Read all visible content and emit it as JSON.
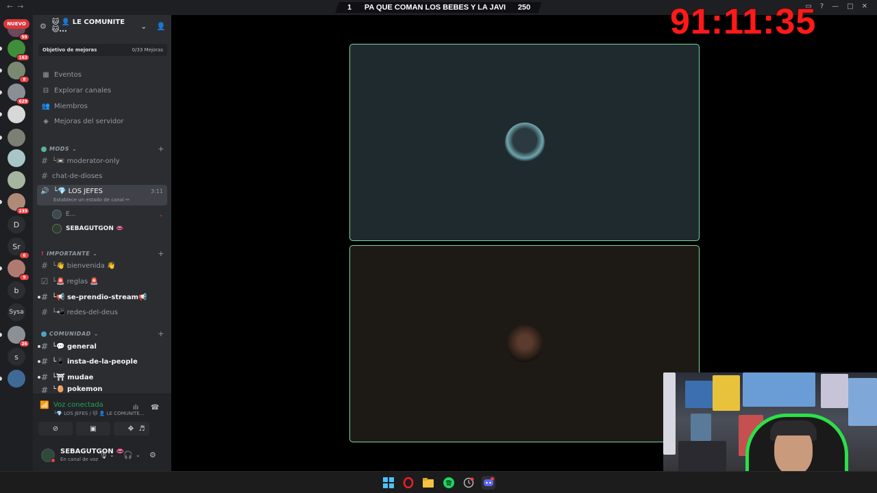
{
  "overlay": {
    "left_value": "1",
    "title": "PA QUE COMAN LOS BEBES Y LA JAVI",
    "right_value": "250"
  },
  "timer": "91:11:35",
  "rail": {
    "new_badge": "NUEVO",
    "servers": [
      {
        "badge": "59"
      },
      {
        "badge": "163"
      },
      {
        "badge": "8"
      },
      {
        "badge": "629"
      },
      {
        "badge": ""
      },
      {
        "badge": ""
      },
      {
        "badge": ""
      },
      {
        "badge": ""
      },
      {
        "badge": "235"
      },
      {
        "label": "D",
        "badge": ""
      },
      {
        "label": "Sr",
        "badge": "6"
      },
      {
        "badge": "9"
      },
      {
        "label": "b",
        "badge": ""
      },
      {
        "label": "Sysa",
        "badge": ""
      },
      {
        "badge": "26"
      },
      {
        "label": "s",
        "badge": ""
      },
      {
        "badge": ""
      }
    ]
  },
  "guild": {
    "name": "🐱 👤 LE COMUNITE 🐱...",
    "goal_label": "Objetivo de mejoras",
    "goal_count": "0/33 Mejoras",
    "nav": [
      {
        "icon": "calendar-icon",
        "label": "Eventos"
      },
      {
        "icon": "compass-icon",
        "label": "Explorar canales"
      },
      {
        "icon": "members-icon",
        "label": "Miembros"
      },
      {
        "icon": "boost-icon",
        "label": "Mejoras del servidor"
      }
    ],
    "categories": {
      "mods": "MODS",
      "importante": "IMPORTANTE",
      "comunidad": "COMUNIDAD"
    },
    "channels": {
      "moderator_only": "└📼 moderator-only",
      "chat_de_dioses": "chat-de-dioses",
      "bienvenida": "└👋 bienvenida 👋",
      "reglas": "└🚨 reglas 🚨",
      "se_prendio_stream": "└📢 se-prendio-stream📢",
      "redes_del_deus": "└📲 redes-del-deus",
      "general": "└💬 general",
      "insta": "└📱 insta-de-la-people",
      "mudae": "└⛩ mudae",
      "pokemon": "└🥚 pokemon"
    },
    "voice_channel": {
      "name": "└💎 LOS JEFES",
      "status_hint": "Establece un estado de canal ✏",
      "time": "3:11",
      "users": [
        {
          "name": "E...",
          "bold": false
        },
        {
          "name": "SEBAGUTGON 👄",
          "bold": true
        }
      ]
    }
  },
  "voice_panel": {
    "title": "Voz conectada",
    "subtitle": "└💎 LOS JEFES / 🐱 👤 LE COMUNITE..."
  },
  "user_panel": {
    "name": "SEBAGUTGON 👄",
    "status": "En canal de voz"
  },
  "colors": {
    "accent_green": "#23a55a",
    "tile_border": "#7fd7a2",
    "timer_red": "#ff1a1a",
    "badge_red": "#f23f42"
  }
}
